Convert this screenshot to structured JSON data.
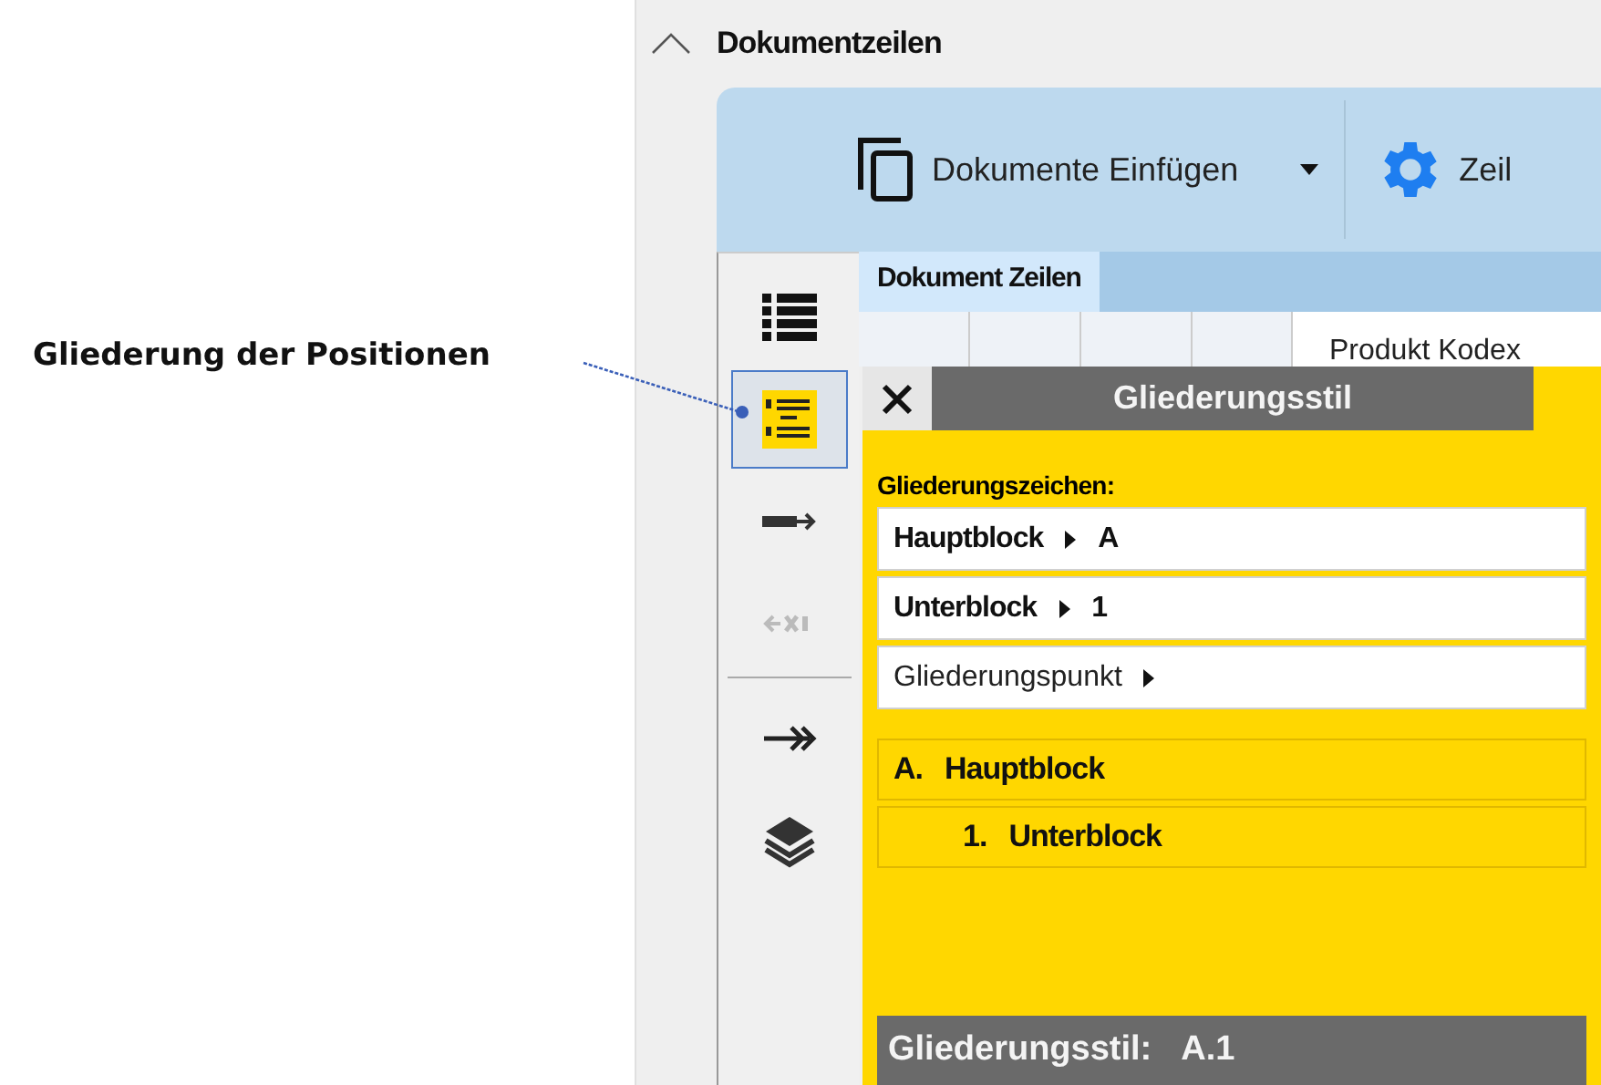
{
  "callout": {
    "text": "Gliederung der Positionen"
  },
  "section": {
    "title": "Dokumentzeilen",
    "expanded": true
  },
  "toolbar": {
    "buttons": [
      {
        "label": "Dokumente Einfügen",
        "kind": "dropdown"
      },
      {
        "label": "Zeil",
        "kind": "settings"
      }
    ]
  },
  "side_tools": [
    {
      "kind": "list",
      "selected": false,
      "disabled": false
    },
    {
      "kind": "outline",
      "selected": true,
      "disabled": false
    },
    {
      "kind": "indent",
      "selected": false,
      "disabled": false
    },
    {
      "kind": "outdent",
      "selected": false,
      "disabled": true
    },
    {
      "kind": "separator"
    },
    {
      "kind": "arrow",
      "selected": false,
      "disabled": false
    },
    {
      "kind": "layers",
      "selected": false,
      "disabled": false
    }
  ],
  "tabs": [
    {
      "label": "Dokument Zeilen",
      "selected": true
    }
  ],
  "grid": {
    "column_5": "Produkt Kodex"
  },
  "popup": {
    "title": "Gliederungsstil",
    "label": "Gliederungszeichen:",
    "levels": [
      {
        "name": "Hauptblock",
        "symbol": "A",
        "bold": true
      },
      {
        "name": "Unterblock",
        "symbol": "1",
        "bold": true
      },
      {
        "name": "Gliederungspunkt",
        "bold": false
      }
    ],
    "preview": [
      {
        "marker": "A.",
        "text": "Hauptblock",
        "children": [
          {
            "marker": "1.",
            "text": "Unterblock"
          }
        ]
      }
    ],
    "footer": {
      "label": "Gliederungsstil:",
      "value": "A.1"
    }
  }
}
